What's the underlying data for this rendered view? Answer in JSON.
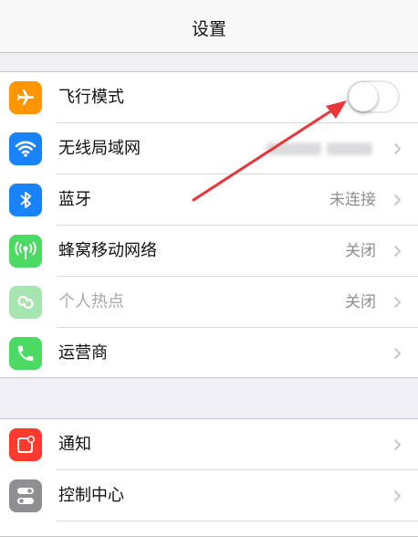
{
  "navbar": {
    "title": "设置"
  },
  "groups": [
    {
      "items": [
        {
          "label": "飞行模式",
          "icon": "airplane-icon",
          "color": "#ff9500",
          "control": "toggle",
          "toggle_on": false
        },
        {
          "label": "无线局域网",
          "icon": "wifi-icon",
          "color": "#1a82fb",
          "control": "chevron",
          "value": ""
        },
        {
          "label": "蓝牙",
          "icon": "bluetooth-icon",
          "color": "#1a82fb",
          "control": "chevron",
          "value": "未连接"
        },
        {
          "label": "蜂窝移动网络",
          "icon": "cellular-icon",
          "color": "#4cd964",
          "control": "chevron",
          "value": "关闭"
        },
        {
          "label": "个人热点",
          "icon": "hotspot-icon",
          "color": "#a6e5b0",
          "control": "chevron",
          "value": "关闭",
          "disabled": true
        },
        {
          "label": "运营商",
          "icon": "phone-icon",
          "color": "#4cd964",
          "control": "chevron",
          "value": ""
        }
      ]
    },
    {
      "items": [
        {
          "label": "通知",
          "icon": "notifications-icon",
          "color": "#ff3b30",
          "control": "chevron"
        },
        {
          "label": "控制中心",
          "icon": "control-center-icon",
          "color": "#8e8e93",
          "control": "chevron"
        }
      ]
    }
  ],
  "annotation": {
    "arrow_color": "#e8363a"
  }
}
